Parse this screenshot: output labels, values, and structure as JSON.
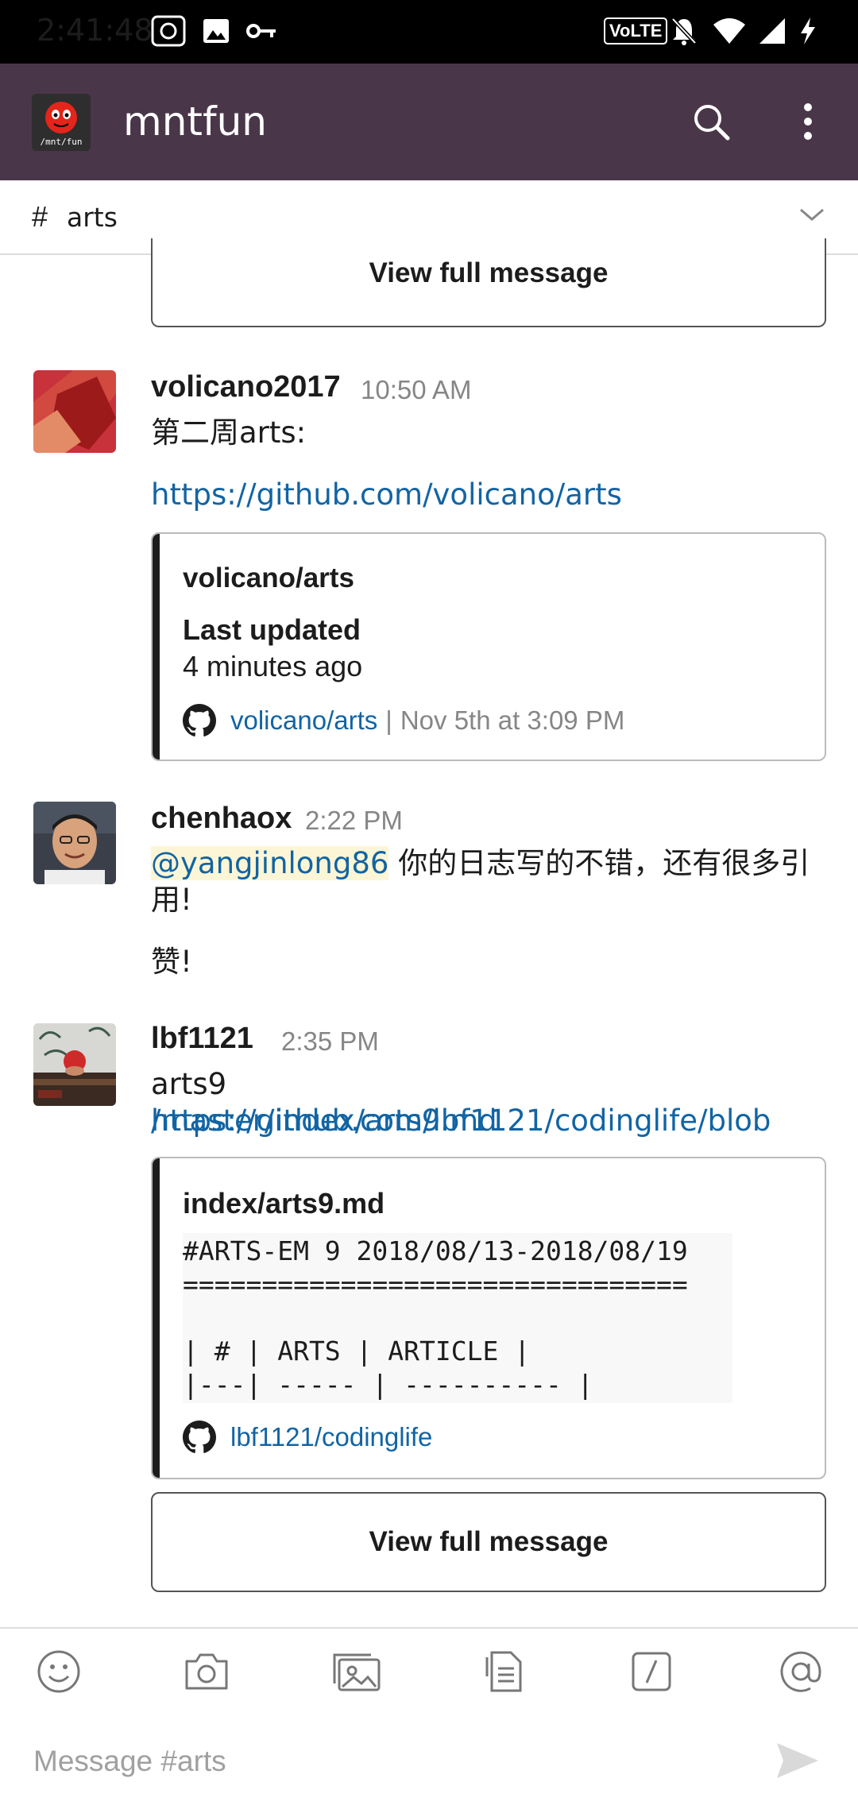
{
  "status_bar": {
    "time": "2:41:48",
    "left_icons": [
      "app-icon",
      "image-icon",
      "key-icon"
    ],
    "right_icons": [
      "volte-icon",
      "bell-off-icon",
      "wifi-icon",
      "signal-icon",
      "charging-icon"
    ],
    "volte_text": "VoLTE"
  },
  "app_bar": {
    "team_logo_text": "/mnt/fun",
    "team_name": "mntfun",
    "search_icon": "search-icon",
    "more_icon": "more-vert-icon"
  },
  "channel_bar": {
    "hash": "#",
    "channel_name": "arts",
    "chevron_icon": "chevron-down-icon"
  },
  "top_view_full_message": "View full message",
  "messages": [
    {
      "user": "volicano2017",
      "time": "10:50 AM",
      "text_line1": "第二周arts:",
      "link": "https://github.com/volicano/arts",
      "attachment": {
        "title": "volicano/arts",
        "field_title": "Last updated",
        "field_value": "4 minutes ago",
        "footer_link": "volicano/arts",
        "footer_sep": "|",
        "footer_time": "Nov 5th at 3:09 PM"
      }
    },
    {
      "user": "chenhaox",
      "time": "2:22 PM",
      "mention": "@yangjinlong86",
      "text_rest_line1": " 你的日志写的不错，还有很多引",
      "text_line2": "用!",
      "text_line3": "赞!"
    },
    {
      "user": "lbf1121",
      "time": "2:35 PM",
      "text_prefix": "arts9 ",
      "link_line1": "https://github.com/lbf1121/codinglife/blob",
      "link_line2": "/master/index/arts9.md",
      "attachment": {
        "title": "index/arts9.md",
        "code_lines": [
          "#ARTS-EM 9 2018/08/13-2018/08/19",
          "================================",
          "",
          "| # | ARTS | ARTICLE |",
          "|---| ----- | ---------- |"
        ],
        "footer_link": "lbf1121/codinglife"
      },
      "view_full_message": "View full message"
    }
  ],
  "composer": {
    "tools": [
      "emoji-icon",
      "camera-icon",
      "photos-icon",
      "file-icon",
      "slash-command-icon",
      "mention-icon"
    ],
    "placeholder": "Message #arts",
    "send_icon": "send-icon"
  }
}
